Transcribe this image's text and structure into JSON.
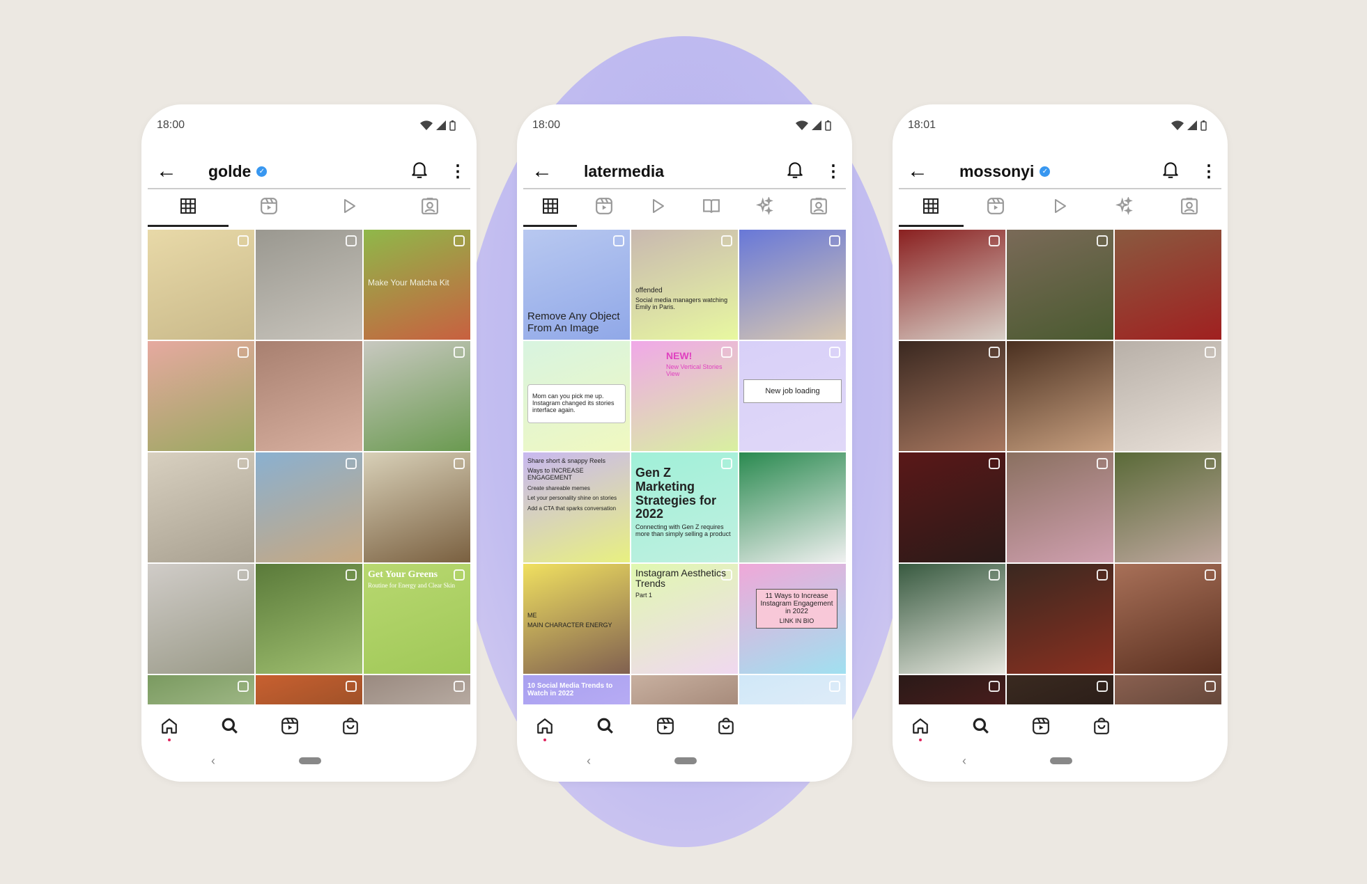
{
  "colors": {
    "background": "#ece8e2",
    "accent_circle": "#b3b0ee",
    "verified": "#3897f0",
    "icon": "#222222",
    "icon_inactive": "#999999"
  },
  "phones": [
    {
      "time": "18:00",
      "username": "golde",
      "verified": true,
      "tabs": [
        "grid-icon",
        "reels-icon",
        "play-icon",
        "tagged-icon"
      ],
      "active_tab": 0,
      "grid": [
        {
          "c": [
            "#e8d9a8",
            "#c9b98a"
          ],
          "badge": true
        },
        {
          "c": [
            "#9a9890",
            "#c8c4bc"
          ],
          "badge": true
        },
        {
          "c": [
            "#8fb84a",
            "#c86040"
          ],
          "badge": true,
          "text": "Make Your Matcha Kit",
          "tc": "#f0f0e0",
          "ty": "top:70px;font-size:12px"
        },
        {
          "c": [
            "#e6a9a0",
            "#9aa860"
          ],
          "badge": true
        },
        {
          "c": [
            "#a88070",
            "#d8b0a0"
          ]
        },
        {
          "c": [
            "#c8c8c0",
            "#6a9a50"
          ],
          "badge": true
        },
        {
          "c": [
            "#d8d0c0",
            "#a8a090"
          ],
          "badge": true
        },
        {
          "c": [
            "#8ab0d0",
            "#c8a880"
          ],
          "badge": true
        },
        {
          "c": [
            "#d8d0b8",
            "#7a6040"
          ],
          "badge": true
        },
        {
          "c": [
            "#d0ccc8",
            "#9a9a88"
          ],
          "badge": true
        },
        {
          "c": [
            "#5a7a3a",
            "#a0c070"
          ],
          "badge": true
        },
        {
          "c": [
            "#b8d870",
            "#a0c858"
          ],
          "badge": true,
          "text": "Get Your Greens",
          "sub": "Routine for Energy and Clear Skin",
          "tc": "#ffffff",
          "ty": "top:8px;font-weight:bold;font-family:'Liberation Serif',serif"
        },
        {
          "c": [
            "#7a9a60",
            "#c8d8b0"
          ],
          "badge": true
        },
        {
          "c": [
            "#c86030",
            "#704020"
          ],
          "badge": true
        },
        {
          "c": [
            "#9a8a80",
            "#d8d0c8"
          ],
          "badge": true
        }
      ],
      "nav": [
        "home-icon",
        "search-icon",
        "reels-icon",
        "shop-icon"
      ]
    },
    {
      "time": "18:00",
      "username": "latermedia",
      "verified": false,
      "tabs": [
        "grid-icon",
        "reels-icon",
        "play-icon",
        "guides-icon",
        "effects-icon",
        "tagged-icon"
      ],
      "active_tab": 0,
      "grid": [
        {
          "c": [
            "#b8c8f0",
            "#90a8e8"
          ],
          "badge": true,
          "text": "Remove Any Object From An Image",
          "ty": "bottom:8px;font-size:15px"
        },
        {
          "c": [
            "#c8b8b0",
            "#e8f8a0"
          ],
          "badge": true,
          "text": "offended",
          "sub": "Social media managers watching Emily in Paris.",
          "ty": "top:82px;font-size:10px"
        },
        {
          "c": [
            "#6878d8",
            "#d8c8b0"
          ],
          "badge": true
        },
        {
          "c": [
            "#d8f4e0",
            "#f0f8c0"
          ],
          "text": "Mom can you pick me up. Instagram changed its stories interface again.",
          "ty": "top:62px;font-size:9px;background:#fff;border:1px solid #bbb;border-radius:4px;padding:12px 6px"
        },
        {
          "c": [
            "#f0a8e8",
            "#d8f0a0"
          ],
          "badge": true,
          "text": "NEW!",
          "sub": "New Vertical Stories View",
          "ty": "top:14px;left:50px;font-weight:bold;color:#e040c0"
        },
        {
          "c": [
            "#d8d0f8",
            "#e0d8f8"
          ],
          "badge": true,
          "text": "New job loading",
          "ty": "top:55px;font-size:11px;text-align:center;background:#fff;border:1px solid #999;padding:10px 4px"
        },
        {
          "c": [
            "#c8b8f0",
            "#e8f080"
          ],
          "text": "Share short & snappy Reels",
          "sub": "Ways to INCREASE ENGAGEMENT",
          "extra": [
            "Create shareable memes",
            "Let your personality shine on stories",
            "Add a CTA that sparks conversation"
          ],
          "ty": "top:8px;font-size:9px"
        },
        {
          "c": [
            "#a0f0d8",
            "#c0f0e0"
          ],
          "badge": true,
          "text": "Gen Z Marketing Strategies for 2022",
          "sub": "Connecting with Gen Z requires more than simply selling a product",
          "ty": "top:20px;font-size:18px;font-weight:bold"
        },
        {
          "c": [
            "#2a8a50",
            "#f0f0f0"
          ]
        },
        {
          "c": [
            "#f0e060",
            "#806050"
          ],
          "text": "ME",
          "sub": "MAIN CHARACTER ENERGY",
          "ty": "top:70px;font-size:9px"
        },
        {
          "c": [
            "#e0f8b0",
            "#f0d8f0"
          ],
          "badge": true,
          "text": "Instagram Aesthetics Trends",
          "sub": "Part 1",
          "ty": "top:6px;font-size:14px"
        },
        {
          "c": [
            "#f0a8d8",
            "#a0e0f0"
          ],
          "text": "11 Ways to Increase Instagram Engagement in 2022",
          "sub": "LINK IN BIO",
          "ty": "top:36px;left:24px;right:12px;font-size:10px;text-align:center;background:#f8c8d8;border:1px solid #555;padding:4px"
        },
        {
          "c": [
            "#a8a0f0",
            "#c8b8f8"
          ],
          "text": "10 Social Media Trends to Watch in 2022",
          "tc": "#ffffff",
          "ty": "top:10px;font-size:10px;font-weight:bold"
        },
        {
          "c": [
            "#c8b0a0",
            "#806050"
          ]
        },
        {
          "c": [
            "#d0e8f8",
            "#f0f0f8"
          ],
          "badge": true
        }
      ],
      "nav": [
        "home-icon",
        "search-icon",
        "reels-icon",
        "shop-icon"
      ]
    },
    {
      "time": "18:01",
      "username": "mossonyi",
      "verified": true,
      "tabs": [
        "grid-icon",
        "reels-icon",
        "play-icon",
        "effects-icon",
        "tagged-icon"
      ],
      "active_tab": 0,
      "grid": [
        {
          "c": [
            "#8a2020",
            "#d8d0c8"
          ],
          "badge": true
        },
        {
          "c": [
            "#7a6a58",
            "#4a5a30"
          ],
          "badge": true
        },
        {
          "c": [
            "#8a5a40",
            "#a02020"
          ]
        },
        {
          "c": [
            "#3a2820",
            "#a87860"
          ],
          "badge": true
        },
        {
          "c": [
            "#4a3020",
            "#c8a080"
          ]
        },
        {
          "c": [
            "#b8b0a8",
            "#e8e0d8"
          ],
          "badge": true
        },
        {
          "c": [
            "#5a1818",
            "#2a1a18"
          ],
          "badge": true
        },
        {
          "c": [
            "#8a7060",
            "#d0a0b0"
          ],
          "badge": true
        },
        {
          "c": [
            "#5a6a38",
            "#c0a8a0"
          ],
          "badge": true
        },
        {
          "c": [
            "#385a40",
            "#e8e8e0"
          ],
          "badge": true
        },
        {
          "c": [
            "#3a2820",
            "#8a3020"
          ],
          "badge": true
        },
        {
          "c": [
            "#a87058",
            "#5a3020"
          ],
          "badge": true
        },
        {
          "c": [
            "#2a1a18",
            "#6a2020"
          ],
          "badge": true
        },
        {
          "c": [
            "#3a2a20",
            "#1a1010"
          ],
          "badge": true
        },
        {
          "c": [
            "#8a6050",
            "#3a2a20"
          ],
          "badge": true
        }
      ],
      "nav": [
        "home-icon",
        "search-icon",
        "reels-icon",
        "shop-icon"
      ]
    }
  ]
}
